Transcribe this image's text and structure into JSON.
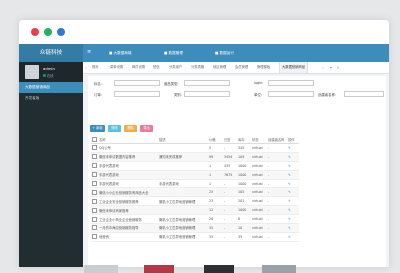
{
  "app": {
    "brand": "众链科技",
    "toggle_icon": "menu-toggle-icon"
  },
  "top_nav": [
    {
      "label": "■ 大数据商城",
      "icon": "grid-icon"
    },
    {
      "label": "■ 数据管理",
      "icon": "grid-icon"
    },
    {
      "label": "■ 数据运行",
      "icon": "grid-icon"
    }
  ],
  "user": {
    "name": "admin",
    "status": "在线"
  },
  "sidebar": {
    "items": [
      {
        "label": "大数据营销商品",
        "active": true
      },
      {
        "label": "开发者版"
      }
    ]
  },
  "tabs": [
    {
      "label": "首页"
    },
    {
      "label": "菜单设置"
    },
    {
      "label": "邮件设置"
    },
    {
      "label": "短信"
    },
    {
      "label": "分类用户"
    },
    {
      "label": "分类表格"
    },
    {
      "label": "地区管理"
    },
    {
      "label": "会员管理"
    },
    {
      "label": "管理模板"
    },
    {
      "label": "大数据营销商品",
      "active": true
    }
  ],
  "filters": {
    "name": "标名:",
    "type": "营品类型:",
    "login": "login:",
    "subscribe": "订单:",
    "order": "类别:",
    "unit": "单位:",
    "create": "创建者名称:"
  },
  "buttons": {
    "add": "+ 新增",
    "edit": "修改",
    "delete": "删除",
    "export": "导出"
  },
  "colors": {
    "add": "#3c8dbc",
    "edit": "#5bc0de",
    "delete": "#f0ad4e",
    "export": "#e87a9a"
  },
  "table": {
    "headers": [
      "",
      "名称",
      "描述",
      "价格",
      "已售",
      "库存",
      "状态",
      "创建者名称",
      "操作"
    ],
    "rows": [
      [
        "",
        "QQ公号",
        "",
        "5",
        "-",
        "345",
        "virtual",
        "-",
        "✎"
      ],
      [
        "",
        "微信未申请数据内容推荐",
        "通知未完成推荐",
        "99",
        "3454",
        "109",
        "virtual",
        "-",
        "✎"
      ],
      [
        "",
        "手游代表游戏",
        "",
        "1",
        "435",
        "1000",
        "virtual",
        "-",
        "✎"
      ],
      [
        "",
        "手游代表游戏",
        "",
        "1",
        "7675",
        "1000",
        "virtual",
        "-",
        "✎"
      ],
      [
        "",
        "手游代表游戏",
        "手游代表游戏",
        "1",
        "-",
        "1000",
        "virtual",
        "-",
        "✎"
      ],
      [
        "",
        "微信小小企业营销服务有商品大全",
        "",
        "25",
        "-",
        "105",
        "virtual",
        "-",
        "✎"
      ],
      [
        "",
        "工业企业安全营销服务推荐",
        "微机小工匹异地营销管理",
        "23",
        "-",
        "201",
        "virtual",
        "-",
        "✎"
      ],
      [
        "",
        "微信未申请商家推荐",
        "",
        "12",
        "-",
        "1000",
        "virtual",
        "-",
        "✎"
      ],
      [
        "",
        "工业企业小商业企业营销服务",
        "微机小工匹异地营销管理",
        "20",
        "-",
        "8",
        "virtual",
        "-",
        "✎"
      ],
      [
        "",
        "一月的中海应营销服务指导",
        "微机小工匹异地营销管理",
        "35",
        "-",
        "10",
        "virtual",
        "-",
        "✎"
      ],
      [
        "",
        "地营资",
        "微机小工匹异地营销管理",
        "35",
        "-",
        "35",
        "virtual",
        "-",
        "✎"
      ]
    ]
  }
}
